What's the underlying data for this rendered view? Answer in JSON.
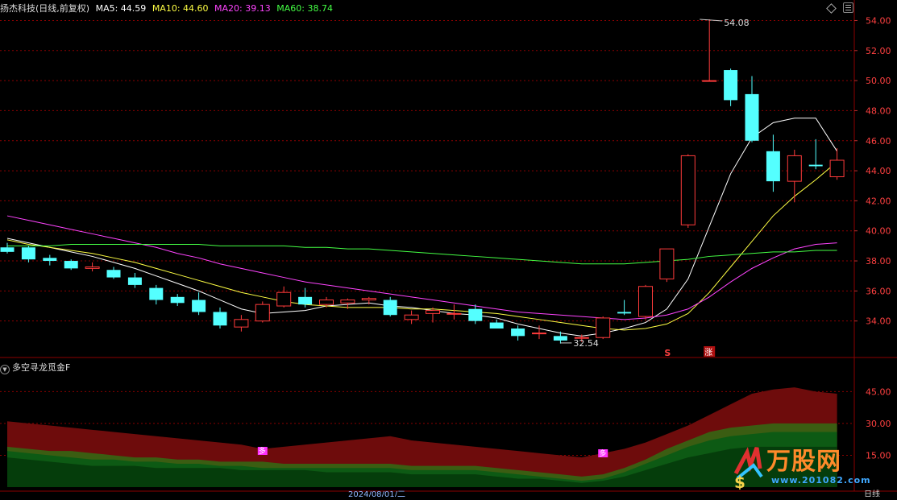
{
  "header": {
    "title": "扬杰科技(日线,前复权)",
    "ma": [
      {
        "label": "MA5: 44.59",
        "color": "#ffffff"
      },
      {
        "label": "MA10: 44.60",
        "color": "#ffff44"
      },
      {
        "label": "MA20: 39.13",
        "color": "#ff44ff"
      },
      {
        "label": "MA60: 38.74",
        "color": "#44ff44"
      }
    ]
  },
  "price_axis": {
    "min": 32.0,
    "max": 54.0,
    "ticks": [
      "54.00",
      "52.00",
      "50.00",
      "48.00",
      "46.00",
      "44.00",
      "42.00",
      "40.00",
      "38.00",
      "36.00",
      "34.00"
    ]
  },
  "annotations": {
    "high": "54.08",
    "low": "32.54",
    "signal_s": "S",
    "signal_zhang": "涨",
    "badge": "多"
  },
  "indicator": {
    "name": "多空寻龙觅金F",
    "ticks": [
      "45.00",
      "30.00",
      "15.00"
    ],
    "max": 55
  },
  "colors": {
    "up": "#ff3b3b",
    "down": "#54ffff",
    "grid": "#8b0000"
  },
  "chart_data": {
    "type": "candlestick",
    "candles": [
      [
        38.9,
        39.2,
        38.5,
        38.6
      ],
      [
        38.9,
        39.0,
        37.9,
        38.1
      ],
      [
        38.2,
        38.4,
        37.7,
        38.0
      ],
      [
        38.0,
        38.1,
        37.4,
        37.5
      ],
      [
        37.5,
        37.9,
        37.3,
        37.6
      ],
      [
        37.4,
        37.6,
        36.8,
        36.9
      ],
      [
        36.9,
        37.2,
        36.2,
        36.4
      ],
      [
        36.2,
        36.4,
        35.1,
        35.4
      ],
      [
        35.6,
        35.8,
        35.0,
        35.2
      ],
      [
        35.4,
        35.9,
        34.4,
        34.6
      ],
      [
        34.6,
        34.9,
        33.5,
        33.7
      ],
      [
        33.6,
        34.4,
        33.3,
        34.1
      ],
      [
        34.0,
        35.3,
        33.9,
        35.1
      ],
      [
        35.0,
        36.3,
        34.9,
        35.9
      ],
      [
        35.6,
        36.2,
        34.9,
        35.1
      ],
      [
        35.1,
        35.6,
        34.9,
        35.4
      ],
      [
        35.2,
        35.5,
        34.8,
        35.4
      ],
      [
        35.4,
        35.6,
        35.1,
        35.5
      ],
      [
        35.4,
        35.6,
        34.3,
        34.4
      ],
      [
        34.1,
        34.7,
        33.8,
        34.4
      ],
      [
        34.5,
        34.9,
        33.9,
        34.7
      ],
      [
        34.5,
        35.1,
        34.1,
        34.5
      ],
      [
        34.8,
        35.1,
        33.8,
        34.0
      ],
      [
        33.9,
        34.1,
        33.5,
        33.5
      ],
      [
        33.5,
        33.7,
        32.7,
        33.0
      ],
      [
        33.2,
        33.7,
        32.8,
        33.2
      ],
      [
        33.0,
        33.3,
        32.5,
        32.7
      ],
      [
        32.9,
        33.1,
        32.6,
        32.9
      ],
      [
        32.9,
        34.3,
        32.8,
        34.2
      ],
      [
        34.6,
        35.4,
        34.4,
        34.5
      ],
      [
        34.3,
        36.4,
        34.1,
        36.3
      ],
      [
        36.8,
        38.8,
        36.6,
        38.8
      ],
      [
        40.4,
        45.1,
        40.2,
        45.0
      ],
      [
        50.0,
        54.08,
        50.0,
        50.0
      ],
      [
        50.7,
        50.8,
        48.3,
        48.7
      ],
      [
        49.1,
        50.3,
        45.9,
        46.0
      ],
      [
        45.3,
        46.4,
        42.6,
        43.3
      ],
      [
        43.3,
        45.4,
        41.9,
        45.0
      ],
      [
        44.4,
        46.1,
        44.1,
        44.3
      ],
      [
        43.6,
        45.5,
        43.4,
        44.7
      ]
    ],
    "series": [
      {
        "name": "MA5",
        "color": "#ffffff",
        "values": [
          39.5,
          39.2,
          38.9,
          38.6,
          38.3,
          37.9,
          37.5,
          37.0,
          36.5,
          36.0,
          35.4,
          34.8,
          34.5,
          34.6,
          34.7,
          35.0,
          35.1,
          35.2,
          35.0,
          34.9,
          34.7,
          34.5,
          34.4,
          34.2,
          33.8,
          33.5,
          33.2,
          33.0,
          33.2,
          33.5,
          33.9,
          34.8,
          36.8,
          40.3,
          43.8,
          46.2,
          47.2,
          47.5,
          47.5,
          45.3
        ]
      },
      {
        "name": "MA10",
        "color": "#ffff44",
        "values": [
          39.4,
          39.1,
          38.9,
          38.7,
          38.5,
          38.2,
          37.9,
          37.5,
          37.1,
          36.7,
          36.3,
          35.9,
          35.6,
          35.3,
          35.1,
          35.0,
          34.9,
          34.9,
          34.9,
          34.8,
          34.8,
          34.7,
          34.6,
          34.5,
          34.3,
          34.1,
          33.9,
          33.7,
          33.5,
          33.4,
          33.5,
          33.8,
          34.5,
          35.9,
          37.6,
          39.3,
          41.0,
          42.3,
          43.4,
          44.6
        ]
      },
      {
        "name": "MA20",
        "color": "#ff44ff",
        "values": [
          41.0,
          40.7,
          40.4,
          40.1,
          39.8,
          39.5,
          39.2,
          38.9,
          38.5,
          38.2,
          37.8,
          37.5,
          37.2,
          36.9,
          36.6,
          36.4,
          36.2,
          36.0,
          35.8,
          35.6,
          35.4,
          35.2,
          35.0,
          34.8,
          34.6,
          34.5,
          34.4,
          34.3,
          34.2,
          34.1,
          34.2,
          34.4,
          34.8,
          35.6,
          36.6,
          37.5,
          38.2,
          38.8,
          39.1,
          39.2
        ]
      },
      {
        "name": "MA60",
        "color": "#44ff44",
        "values": [
          39.0,
          39.0,
          39.0,
          39.1,
          39.1,
          39.1,
          39.1,
          39.1,
          39.1,
          39.1,
          39.0,
          39.0,
          39.0,
          39.0,
          38.9,
          38.9,
          38.8,
          38.8,
          38.7,
          38.6,
          38.5,
          38.4,
          38.3,
          38.2,
          38.1,
          38.0,
          37.9,
          37.8,
          37.8,
          37.8,
          37.9,
          38.0,
          38.1,
          38.3,
          38.4,
          38.5,
          38.6,
          38.6,
          38.7,
          38.7
        ]
      }
    ],
    "indicator_layers": [
      {
        "color": "#6e0c0c",
        "values": [
          31,
          30,
          29,
          28,
          27,
          26,
          25,
          24,
          23,
          22,
          21,
          20,
          18,
          19,
          20,
          21,
          22,
          23,
          24,
          22,
          21,
          20,
          19,
          18,
          17,
          16,
          15,
          14,
          16,
          18,
          21,
          25,
          29,
          34,
          39,
          44,
          46,
          47,
          45,
          44
        ]
      },
      {
        "color": "#3b5d12",
        "values": [
          19,
          18,
          17,
          17,
          16,
          15,
          14,
          14,
          13,
          13,
          12,
          12,
          12,
          11,
          11,
          11,
          11,
          11,
          11,
          10,
          10,
          10,
          10,
          9,
          8,
          7,
          6,
          5,
          6,
          9,
          13,
          18,
          22,
          26,
          28,
          29,
          30,
          30,
          30,
          30
        ]
      },
      {
        "color": "#0d5a14",
        "values": [
          17,
          16,
          15,
          14,
          13,
          13,
          12,
          12,
          11,
          11,
          10,
          10,
          9,
          9,
          9,
          9,
          9,
          9,
          9,
          8,
          8,
          8,
          8,
          7,
          6,
          5,
          4,
          3,
          4,
          7,
          11,
          15,
          19,
          22,
          24,
          25,
          26,
          26,
          26,
          26
        ]
      },
      {
        "color": "#053d0b",
        "values": [
          14,
          13,
          12,
          11,
          10,
          10,
          10,
          9,
          9,
          9,
          9,
          8,
          8,
          8,
          8,
          7,
          7,
          7,
          7,
          6,
          6,
          6,
          6,
          5,
          4,
          4,
          3,
          2,
          3,
          5,
          8,
          11,
          14,
          16,
          18,
          19,
          19,
          19,
          19,
          19
        ]
      }
    ]
  },
  "logo": {
    "text": "万股网",
    "url": "www.201082.com"
  },
  "footer": {
    "date": "2024/08/01/二",
    "period": "日线"
  }
}
